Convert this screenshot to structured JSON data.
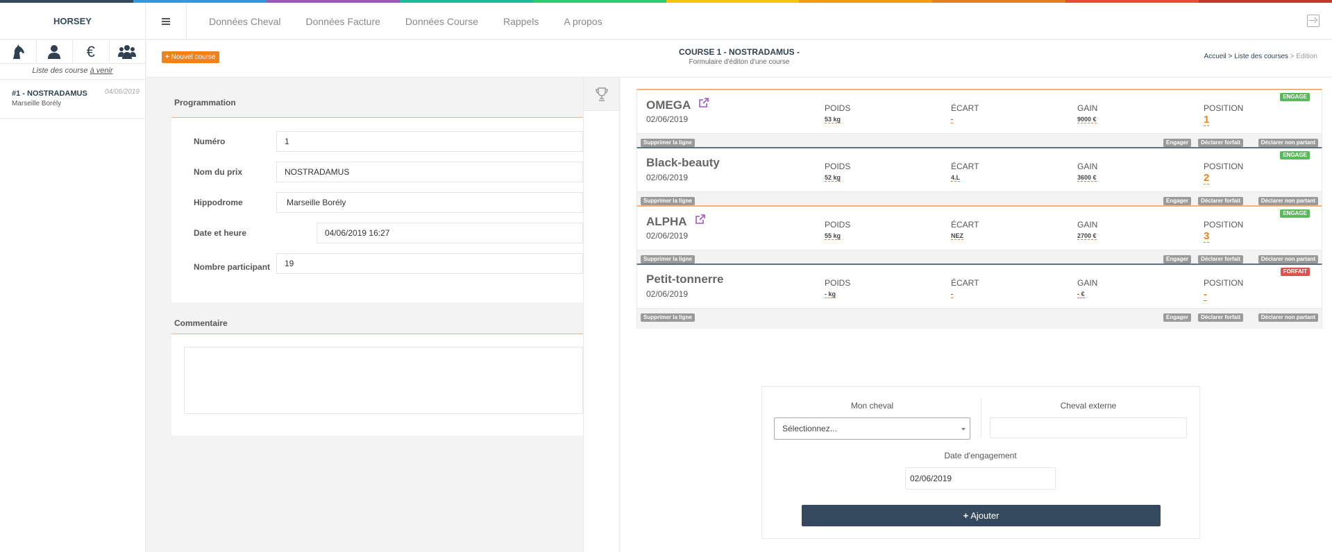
{
  "colors": {
    "rainbow": [
      "#34495e",
      "#3498db",
      "#9b59b6",
      "#1abc9c",
      "#2ecc71",
      "#f1c40f",
      "#f39c12",
      "#e67e22",
      "#e74c3c",
      "#c0392b"
    ],
    "accent_orange": "#f0821e",
    "navy": "#34495e",
    "engage_green": "#5cb85c",
    "forfait_red": "#d9534f"
  },
  "app": {
    "brand": "HORSEY"
  },
  "nav": {
    "items": [
      "Données Cheval",
      "Données Facture",
      "Données Course",
      "Rappels",
      "A propos"
    ]
  },
  "sidebar": {
    "icons": [
      "horse-icon",
      "user-icon",
      "euro-icon",
      "users-icon"
    ],
    "euro_glyph": "€",
    "caption_prefix": "Liste des course ",
    "caption_link": "à venir",
    "items": [
      {
        "title": "#1 - NOSTRADAMUS",
        "subtitle": "Marseille Borély",
        "date": "04/06/2019"
      }
    ]
  },
  "header": {
    "new_button": "Nouvel course",
    "title": "COURSE 1 - NOSTRADAMUS -",
    "subtitle": "Formulaire d'éditon d'une course",
    "breadcrumb": {
      "home": "Accueil",
      "sep": " > ",
      "list": "Liste des courses",
      "current": "Edition"
    }
  },
  "form": {
    "section_title": "Programmation",
    "fields": [
      {
        "label": "Numéro",
        "value": "1"
      },
      {
        "label": "Nom du prix",
        "value": "NOSTRADAMUS"
      },
      {
        "label": "Hippodrome",
        "value": "Marseille Borély"
      },
      {
        "label": "Date et heure",
        "value": "04/06/2019 16:27"
      },
      {
        "label": "Nombre participant",
        "value": "19"
      }
    ],
    "comment_title": "Commentaire"
  },
  "columns": {
    "weight": "POIDS",
    "gap": "ÉCART",
    "gain": "GAIN",
    "position": "POSITION"
  },
  "actions": {
    "delete": "Supprimer la ligne",
    "engage": "Engager",
    "forfeit": "Déclarer forfait",
    "non_starter": "Déclarer non partant"
  },
  "horses": [
    {
      "name": "OMEGA",
      "external": true,
      "date": "02/06/2019",
      "weight": "53 kg",
      "gap": "-",
      "gain": "9000 €",
      "position": "1",
      "status": "ENGAGE",
      "status_color": "#5cb85c",
      "border_color": "#f4b27a"
    },
    {
      "name": "Black-beauty",
      "external": false,
      "date": "02/06/2019",
      "weight": "52 kg",
      "gap": "4.L",
      "gain": "3600 €",
      "position": "2",
      "status": "ENGAGE",
      "status_color": "#5cb85c",
      "border_color": "#5b7087"
    },
    {
      "name": "ALPHA",
      "external": true,
      "date": "02/06/2019",
      "weight": "55 kg",
      "gap": "NEZ",
      "gain": "2700 €",
      "position": "3",
      "status": "ENGAGE",
      "status_color": "#5cb85c",
      "border_color": "#f4b27a"
    },
    {
      "name": "Petit-tonnerre",
      "external": false,
      "date": "02/06/2019",
      "weight": "- kg",
      "gap": "-",
      "gain": "- €",
      "position": "-",
      "status": "FORFAIT",
      "status_color": "#d9534f",
      "border_color": "#5b7087"
    }
  ],
  "add_form": {
    "my_horse_label": "Mon cheval",
    "my_horse_value": "Sélectionnez...",
    "external_label": "Cheval externe",
    "external_value": "",
    "date_label": "Date d'engagement",
    "date_value": "02/06/2019",
    "submit": "Ajouter"
  }
}
